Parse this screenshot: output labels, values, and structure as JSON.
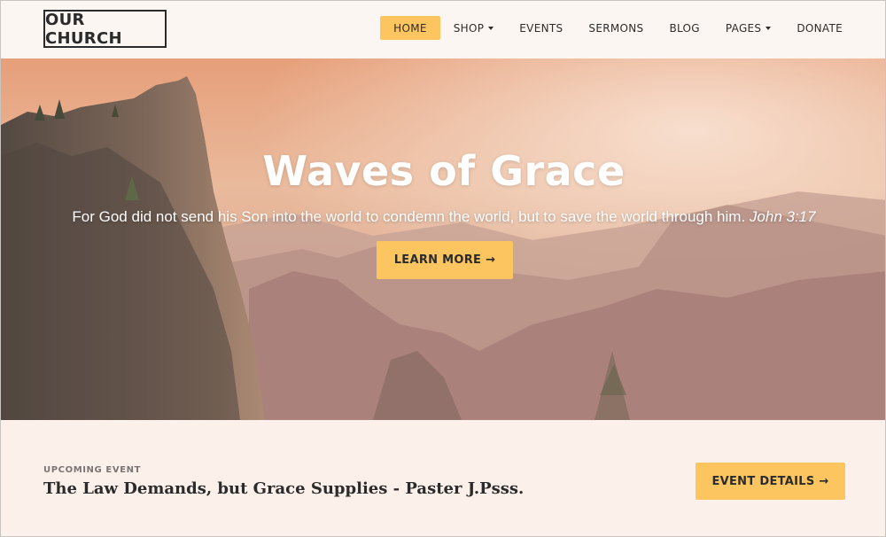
{
  "brand": {
    "logo_text": "OUR CHURCH"
  },
  "nav": {
    "items": [
      {
        "label": "HOME",
        "active": true,
        "dropdown": false
      },
      {
        "label": "SHOP",
        "active": false,
        "dropdown": true
      },
      {
        "label": "EVENTS",
        "active": false,
        "dropdown": false
      },
      {
        "label": "SERMONS",
        "active": false,
        "dropdown": false
      },
      {
        "label": "BLOG",
        "active": false,
        "dropdown": false
      },
      {
        "label": "PAGES",
        "active": false,
        "dropdown": true
      },
      {
        "label": "DONATE",
        "active": false,
        "dropdown": false
      }
    ]
  },
  "hero": {
    "title": "Waves of Grace",
    "verse_text": "For God did not send his Son into the world to condemn the world, but to save the world through him.",
    "verse_ref": "John 3:17",
    "cta_label": "LEARN MORE →"
  },
  "event": {
    "kicker": "UPCOMING EVENT",
    "title": "The Law Demands, but Grace Supplies - Paster J.Psss.",
    "cta_label": "EVENT DETAILS →"
  },
  "colors": {
    "accent": "#fcc55f",
    "text_dark": "#2b2b2b",
    "header_bg": "#fbf6f2",
    "event_bg": "#fbf1ea"
  }
}
